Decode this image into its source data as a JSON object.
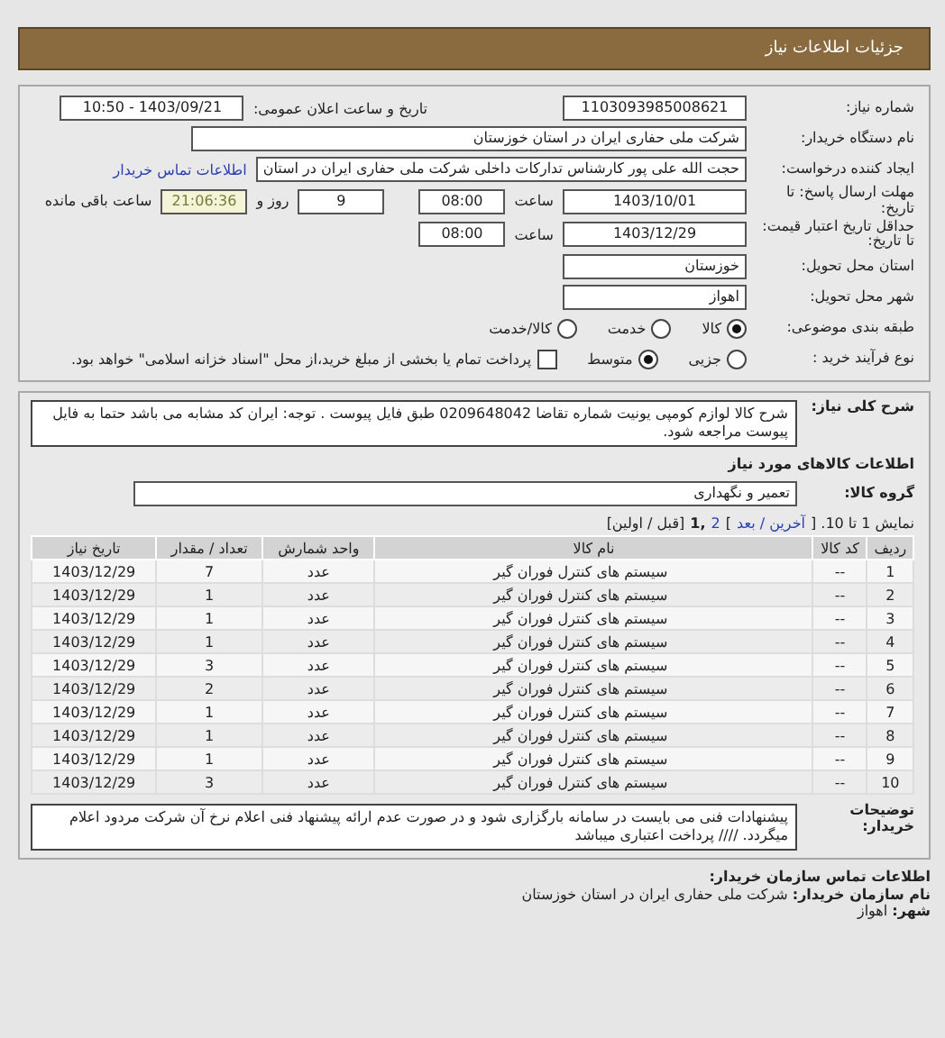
{
  "header": {
    "title": "جزئیات اطلاعات نیاز"
  },
  "need_number": {
    "label": "شماره نیاز:",
    "value": "1103093985008621"
  },
  "announce": {
    "label": "تاریخ و ساعت اعلان عمومی:",
    "value": "1403/09/21 - 10:50"
  },
  "buyer_org": {
    "label": "نام دستگاه خریدار:",
    "value": "شرکت ملی حفاری ایران در استان خوزستان"
  },
  "requester": {
    "label": "ایجاد کننده درخواست:",
    "value": "حجت الله علی پور کارشناس تدارکات داخلی شرکت ملی حفاری ایران در استان",
    "link": "اطلاعات تماس خریدار"
  },
  "reply_deadline": {
    "label": "مهلت ارسال پاسخ: تا تاریخ:",
    "date": "1403/10/01",
    "time_label": "ساعت",
    "time": "08:00",
    "days": "9",
    "days_label": "روز و",
    "remaining": "21:06:36",
    "remaining_label": "ساعت باقی مانده"
  },
  "price_validity": {
    "label": "حداقل تاریخ اعتبار قیمت: تا تاریخ:",
    "date": "1403/12/29",
    "time_label": "ساعت",
    "time": "08:00"
  },
  "delivery_province": {
    "label": "استان محل تحویل:",
    "value": "خوزستان"
  },
  "delivery_city": {
    "label": "شهر محل تحویل:",
    "value": "اهواز"
  },
  "category": {
    "label": "طبقه بندی موضوعی:",
    "options": [
      {
        "label": "کالا",
        "selected": true
      },
      {
        "label": "خدمت",
        "selected": false
      },
      {
        "label": "کالا/خدمت",
        "selected": false
      }
    ]
  },
  "process": {
    "label": "نوع فرآیند خرید :",
    "options": [
      {
        "label": "جزیی",
        "selected": false
      },
      {
        "label": "متوسط",
        "selected": true
      }
    ],
    "payment": {
      "label": "پرداخت تمام یا بخشی از مبلغ خرید،از محل \"اسناد خزانه اسلامی\" خواهد بود.",
      "checked": false
    }
  },
  "description": {
    "label": "شرح کلی نیاز:",
    "text": "شرح کالا لوازم کومپی یونیت شماره تقاضا 0209648042 طبق فایل پیوست . توجه: ایران کد مشابه می باشد حتما به فایل پیوست مراجعه شود."
  },
  "goods_title": "اطلاعات کالاهای مورد نیاز",
  "group": {
    "label": "گروه کالا:",
    "value": "تعمیر و نگهداری"
  },
  "pagination": [
    {
      "kind": "plain",
      "text": "نمایش 1 تا 10. ["
    },
    {
      "kind": "link",
      "text": "آخرین / بعد"
    },
    {
      "kind": "plain",
      "text": "]"
    },
    {
      "kind": "link",
      "text": "2"
    },
    {
      "kind": "current",
      "text": ",1"
    },
    {
      "kind": "plain",
      "text": "[قبل / اولین]"
    }
  ],
  "table": {
    "columns": [
      "ردیف",
      "کد کالا",
      "نام کالا",
      "واحد شمارش",
      "تعداد / مقدار",
      "تاریخ نیاز"
    ],
    "rows": [
      [
        "1",
        "--",
        "سیستم های کنترل فوران گیر",
        "عدد",
        "7",
        "1403/12/29"
      ],
      [
        "2",
        "--",
        "سیستم های کنترل فوران گیر",
        "عدد",
        "1",
        "1403/12/29"
      ],
      [
        "3",
        "--",
        "سیستم های کنترل فوران گیر",
        "عدد",
        "1",
        "1403/12/29"
      ],
      [
        "4",
        "--",
        "سیستم های کنترل فوران گیر",
        "عدد",
        "1",
        "1403/12/29"
      ],
      [
        "5",
        "--",
        "سیستم های کنترل فوران گیر",
        "عدد",
        "3",
        "1403/12/29"
      ],
      [
        "6",
        "--",
        "سیستم های کنترل فوران گیر",
        "عدد",
        "2",
        "1403/12/29"
      ],
      [
        "7",
        "--",
        "سیستم های کنترل فوران گیر",
        "عدد",
        "1",
        "1403/12/29"
      ],
      [
        "8",
        "--",
        "سیستم های کنترل فوران گیر",
        "عدد",
        "1",
        "1403/12/29"
      ],
      [
        "9",
        "--",
        "سیستم های کنترل فوران گیر",
        "عدد",
        "1",
        "1403/12/29"
      ],
      [
        "10",
        "--",
        "سیستم های کنترل فوران گیر",
        "عدد",
        "3",
        "1403/12/29"
      ]
    ]
  },
  "buyer_notes": {
    "label": "توضیحات خریدار:",
    "text": "پیشنهادات فنی می بایست در سامانه بارگزاری شود و در صورت عدم ارائه پیشنهاد فنی اعلام نرخ آن شرکت مردود اعلام میگردد. //// پرداخت اعتباری میباشد"
  },
  "contact": {
    "title": "اطلاعات تماس سازمان خریدار:",
    "org_label": "نام سازمان خریدار:",
    "org_value": "شرکت ملی حفاری ایران در استان خوزستان",
    "city_label": "شهر:",
    "city_value": "اهواز"
  }
}
